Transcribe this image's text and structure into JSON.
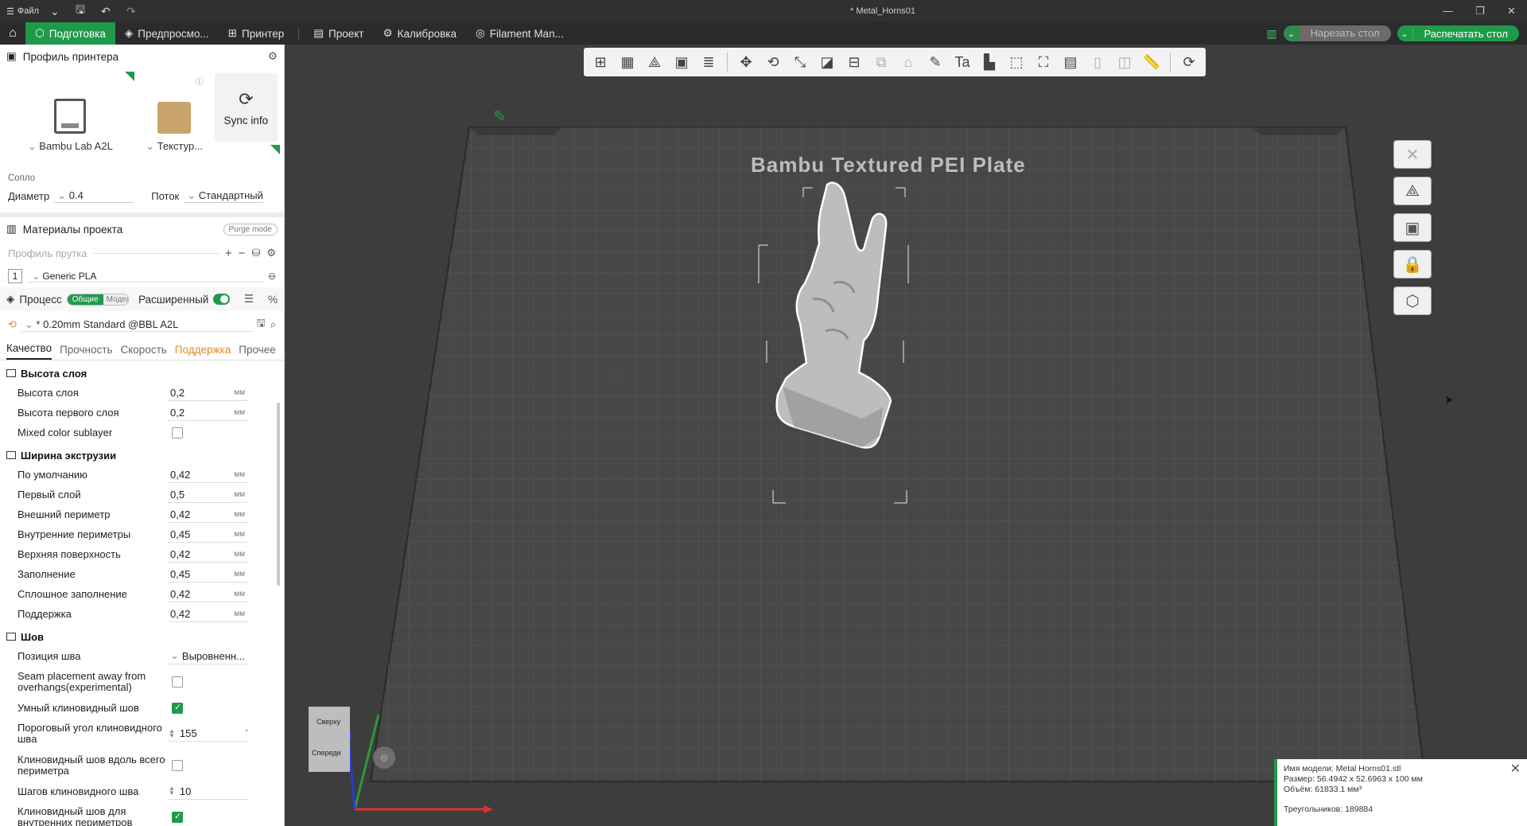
{
  "titlebar": {
    "file_menu": "Файл",
    "title": "* Metal_Horns01"
  },
  "nav": {
    "tabs": [
      {
        "label": "Подготовка"
      },
      {
        "label": "Предпросмо..."
      },
      {
        "label": "Принтер"
      },
      {
        "label": "Проект"
      },
      {
        "label": "Калибровка"
      },
      {
        "label": "Filament Man..."
      }
    ],
    "slice_button": "Нарезать стол",
    "print_button": "Распечатать стол"
  },
  "printer_profile": {
    "title": "Профиль принтера",
    "printer_name": "Bambu Lab A2L",
    "plate_name": "Текстур...",
    "sync_label": "Sync info",
    "nozzle_label": "Сопло",
    "diameter_label": "Диаметр",
    "diameter_value": "0.4",
    "flow_label": "Поток",
    "flow_value": "Стандартный"
  },
  "materials": {
    "title": "Материалы проекта",
    "purge_mode": "Purge mode",
    "filament_profile_label": "Профиль прутка",
    "slot_number": "1",
    "filament_name": "Generic PLA"
  },
  "process": {
    "title": "Процесс",
    "toggle_on": "Общие",
    "toggle_off": "Модели",
    "advanced_label": "Расширенный",
    "preset": "* 0.20mm Standard @BBL A2L",
    "tabs": [
      "Качество",
      "Прочность",
      "Скорость",
      "Поддержка",
      "Прочее"
    ]
  },
  "groups": {
    "layer_height": {
      "title": "Высота слоя",
      "rows": [
        {
          "name": "Высота слоя",
          "value": "0,2",
          "unit": "мм"
        },
        {
          "name": "Высота первого слоя",
          "value": "0,2",
          "unit": "мм"
        }
      ],
      "mixed_color": "Mixed color sublayer"
    },
    "line_width": {
      "title": "Ширина экструзии",
      "rows": [
        {
          "name": "По умолчанию",
          "value": "0,42",
          "unit": "мм"
        },
        {
          "name": "Первый слой",
          "value": "0,5",
          "unit": "мм"
        },
        {
          "name": "Внешний периметр",
          "value": "0,42",
          "unit": "мм"
        },
        {
          "name": "Внутренние периметры",
          "value": "0,45",
          "unit": "мм"
        },
        {
          "name": "Верхняя поверхность",
          "value": "0,42",
          "unit": "мм"
        },
        {
          "name": "Заполнение",
          "value": "0,45",
          "unit": "мм"
        },
        {
          "name": "Сплошное заполнение",
          "value": "0,42",
          "unit": "мм"
        },
        {
          "name": "Поддержка",
          "value": "0,42",
          "unit": "мм"
        }
      ]
    },
    "seam": {
      "title": "Шов",
      "position_label": "Позиция шва",
      "position_value": "Выровненн...",
      "away_label": "Seam placement away from overhangs(experimental)",
      "smart_label": "Умный клиновидный шов",
      "angle_label": "Пороговый угол клиновидного шва",
      "angle_value": "155",
      "angle_unit": "°",
      "perimeter_label": "Клиновидный шов вдоль всего периметра",
      "steps_label": "Шагов клиновидного шва",
      "steps_value": "10",
      "inner_label": "Клиновидный шов для внутренних периметров"
    }
  },
  "viewport": {
    "plate_label": "Bambu Textured PEI Plate"
  },
  "cube": {
    "top": "Сверху",
    "front": "Спереди"
  },
  "info": {
    "model_name": "Имя модели: Metal Horns01.stl",
    "size": "Размер: 56.4942 x 52.6963 x 100 мм",
    "volume": "Объём: 61833.1 мм³",
    "triangles": "Треугольников: 189884"
  },
  "colors": {
    "accent": "#1f9a4b",
    "plate": "#4a4a4a",
    "grid": "#5e5e5e"
  }
}
